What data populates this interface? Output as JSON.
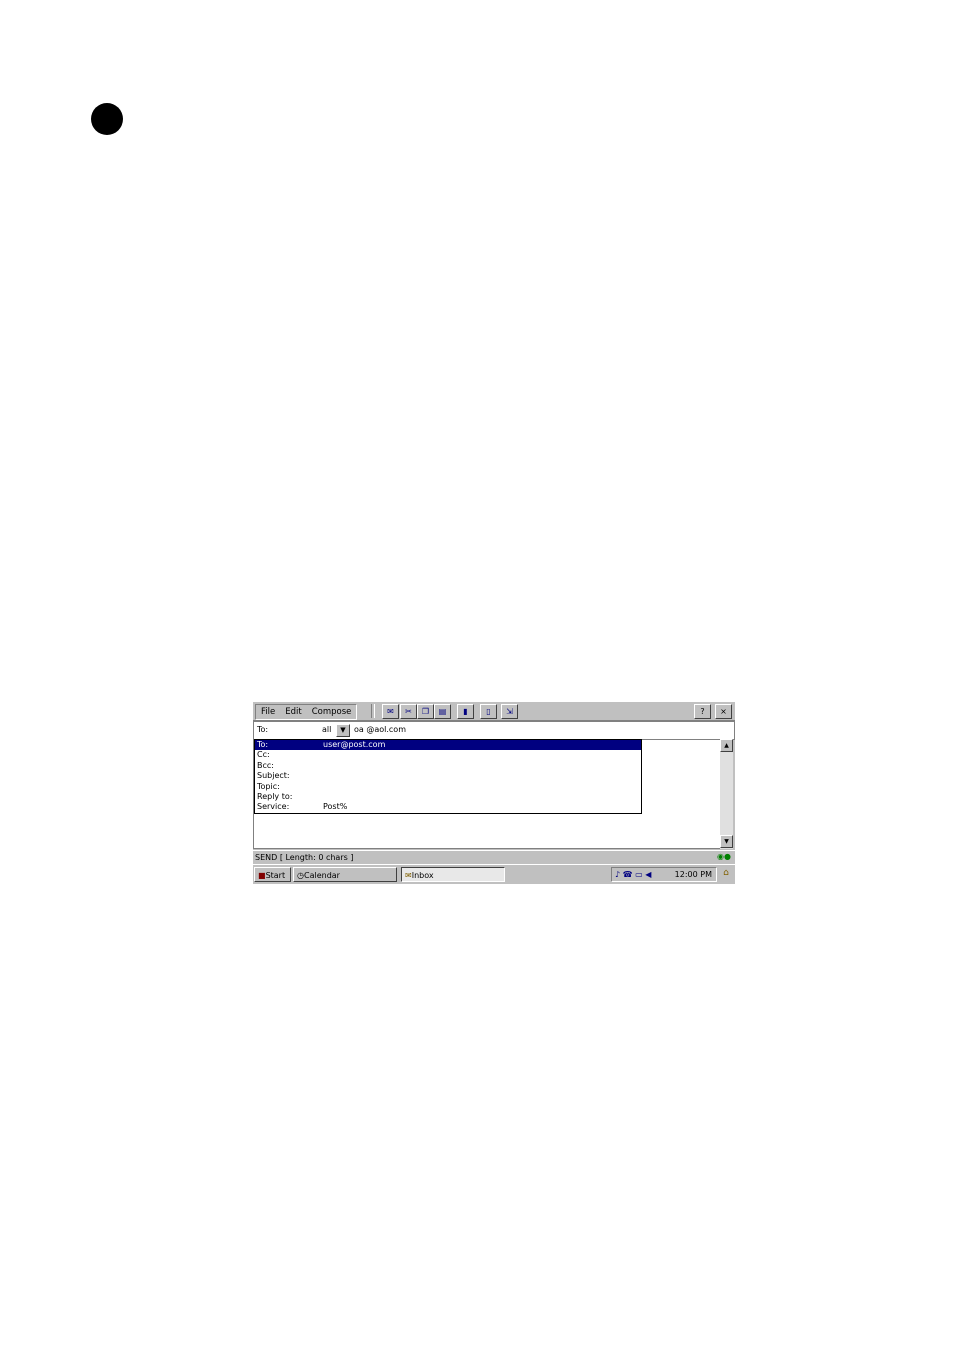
{
  "menu": {
    "file": "File",
    "edit": "Edit",
    "compose": "Compose"
  },
  "window_buttons": {
    "help": "?",
    "close": "×"
  },
  "to_field": {
    "label": "To:",
    "combo_value": "all",
    "value": "oa @aol.com"
  },
  "dropdown_items": [
    {
      "key": "To:",
      "value": "user@post.com",
      "selected": true
    },
    {
      "key": "Cc:",
      "value": ""
    },
    {
      "key": "Bcc:",
      "value": ""
    },
    {
      "key": "Subject:",
      "value": ""
    },
    {
      "key": "Topic:",
      "value": ""
    },
    {
      "key": "Reply to:",
      "value": ""
    },
    {
      "key": "Service:",
      "value": "Post%"
    }
  ],
  "status": {
    "text": "SEND [ Length: 0 chars ]"
  },
  "taskbar": {
    "start": "Start",
    "task1": "Calendar",
    "task2": "Inbox",
    "clock": "12:00 PM"
  },
  "colors": {
    "selection": "#000080",
    "chrome": "#c0c0c0"
  }
}
